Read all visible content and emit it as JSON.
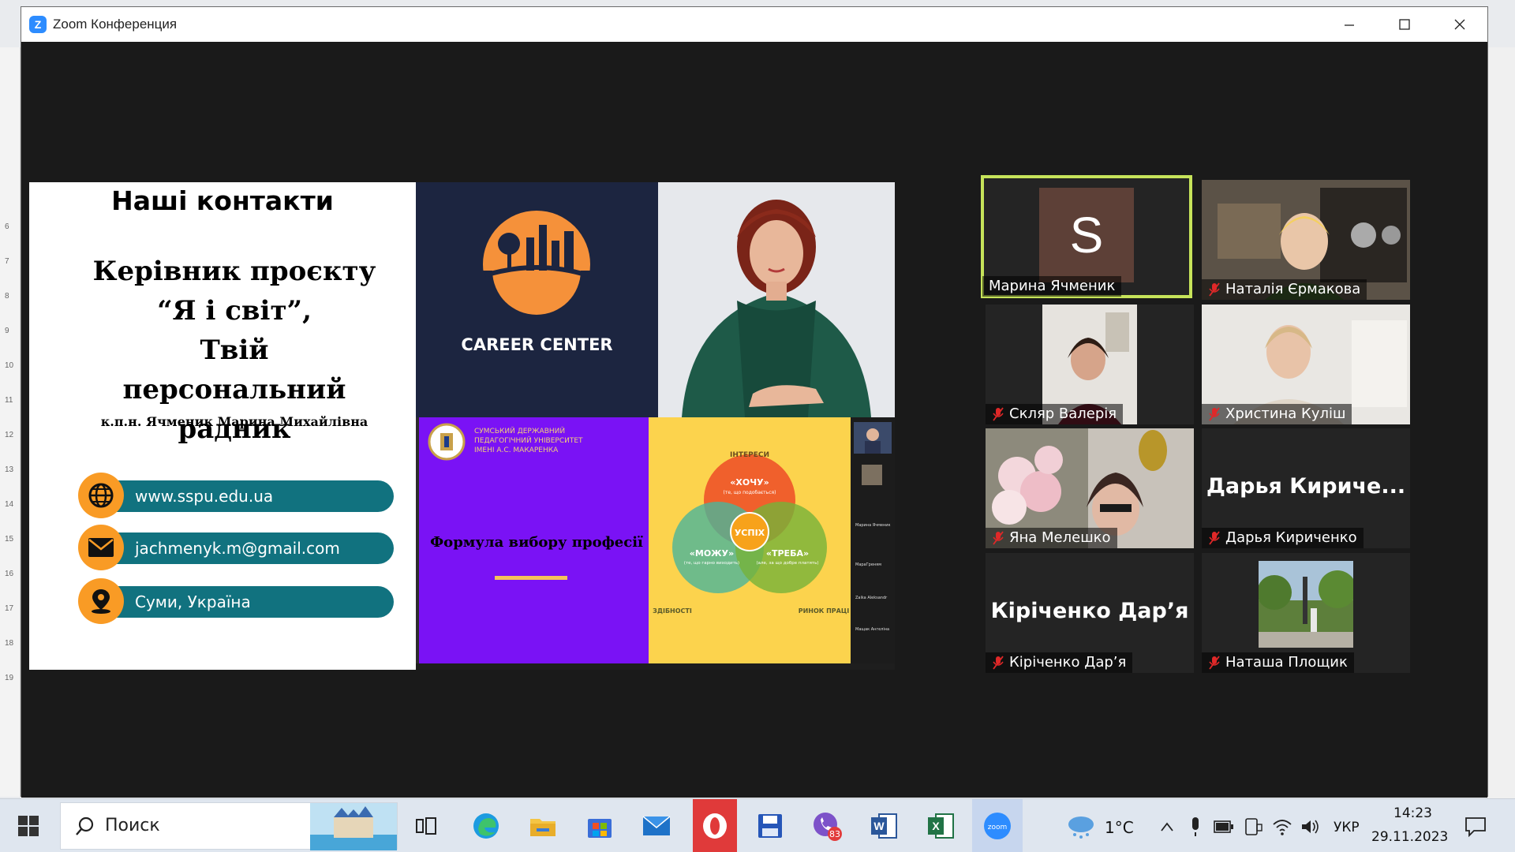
{
  "window": {
    "title": "Zoom Конференция"
  },
  "word": {
    "ruler_numbers": [
      "6",
      "7",
      "8",
      "9",
      "10",
      "11",
      "12",
      "13",
      "14",
      "15",
      "16",
      "17",
      "18",
      "19"
    ]
  },
  "slide": {
    "heading": "Наші контакти",
    "lines": [
      "Керівник проєкту",
      "“Я і світ”,",
      "Твій",
      "персональний радник"
    ],
    "name": "к.п.н. Ячменик Марина Михайлівна",
    "contacts": [
      {
        "icon": "globe-icon",
        "text": "www.sspu.edu.ua"
      },
      {
        "icon": "mail-icon",
        "text": "jachmenyk.m@gmail.com"
      },
      {
        "icon": "location-pin-icon",
        "text": "Суми, Україна"
      }
    ],
    "career_center": "CAREER CENTER",
    "university": [
      "СУМСЬКИЙ ДЕРЖАВНИЙ",
      "ПЕДАГОГІЧНИЙ УНІВЕРСИТЕТ",
      "ІМЕНІ А.С. МАКАРЕНКА"
    ],
    "formula_title": "Формула вибору професії",
    "venn": {
      "top_label": "ІНТЕРЕСИ",
      "want": "«ХОЧУ»",
      "want_sub": "(те, що подобається)",
      "can": "«МОЖУ»",
      "can_sub": "(те, що гарно виходить)",
      "need": "«ТРЕБА»",
      "need_sub": "(але, за що добре платять)",
      "success": "УСПІХ",
      "bottom_left": "ЗДІБНОСТІ",
      "bottom_right": "РИНОК ПРАЦІ"
    },
    "thumb_labels": [
      "Марина Ячменик",
      "МарaГреням",
      "Zaika Aleksandr",
      "Мащак Ангеліна"
    ]
  },
  "participants": [
    {
      "name": "Марина  Ячменик",
      "muted": false,
      "avatar_letter": "S",
      "active": true
    },
    {
      "name": "Наталія  Єрмакова",
      "muted": true
    },
    {
      "name": "Скляр Валерія",
      "muted": true
    },
    {
      "name": "Христина Куліш",
      "muted": true
    },
    {
      "name": "Яна Мелешко",
      "muted": true
    },
    {
      "name": "Дарья Кириченко",
      "muted": true,
      "big_label": "Дарья  Кириче..."
    },
    {
      "name": "Кіріченко Дар’я",
      "muted": true,
      "big_label": "Кіріченко Дар’я"
    },
    {
      "name": "Наташа Площик",
      "muted": true
    }
  ],
  "taskbar": {
    "search_placeholder": "Поиск",
    "viber_badge": "83",
    "temperature": "1°C",
    "language": "УКР",
    "time": "14:23",
    "date": "29.11.2023"
  },
  "colors": {
    "zoom_blue": "#2d8cff",
    "active_speaker": "#c6e35a",
    "contact_teal": "#11727f",
    "contact_orange": "#f99b25",
    "purple_slide": "#7a12f5"
  }
}
